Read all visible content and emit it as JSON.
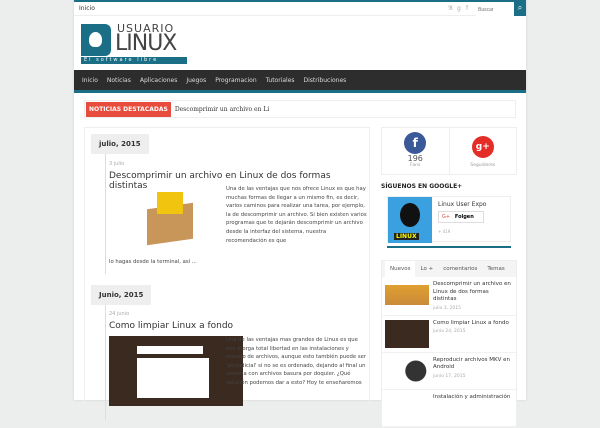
{
  "topbar": {
    "home": "Inicio",
    "search_placeholder": "Buscar"
  },
  "logo": {
    "line1": "USUARIO",
    "line2": "LINUX",
    "tagline": "El software libre"
  },
  "nav": [
    "Inicio",
    "Noticias",
    "Aplicaciones",
    "Juegos",
    "Programacion",
    "Tutoriales",
    "Distribuciones"
  ],
  "ticker": {
    "label": "NOTICIAS DESTACADAS",
    "text": "Descomprimir un archivo en Li"
  },
  "posts": [
    {
      "month": "julio, 2015",
      "date": "3 julio",
      "title": "Descomprimir un archivo en Linux de dos formas distintas",
      "excerpt": "Una de las ventajas que nos ofrece Linux es que hay muchas formas de llegar a un mismo fin, es decir, varios caminos para realizar una tarea, por ejemplo, la de descomprimir un archivo. Si bien existen varios programas que te dejarán descomprimir un archivo desde la interfaz del sistema, nuestra recomendación es que",
      "excerpt_end": "lo hagas desde la terminal, así ..."
    },
    {
      "month": "Junio, 2015",
      "date": "24 junio",
      "title": "Como limpiar Linux a fondo",
      "excerpt": "Una de las ventajas mas grandes de Linux es que nos otorga total libertad en las instalaciones y manejo de archivos, aunque esto también puede ser 'perjudicial' si no se es ordenado, dejando al final un sistema con archivos basura por doquier. ¿Qué solución podemos dar a esto? Hoy te enseñaremos"
    }
  ],
  "social": {
    "fb_count": "196",
    "fb_label": "Fans",
    "gp_label": "Seguidores"
  },
  "gplus": {
    "heading": "SÍGUENOS EN GOOGLE+",
    "page": "Linux User Expo",
    "follow": "Folgen",
    "count": "+ 419",
    "img_text": "LINUX"
  },
  "tabs": [
    "Nuevos",
    "Lo +",
    "comentarios",
    "Temas"
  ],
  "recent": [
    {
      "title": "Descomprimir un archivo en Linux de dos formas distintas",
      "date": "julio 3, 2015"
    },
    {
      "title": "Como limpiar Linux a fondo",
      "date": "junio 24, 2015"
    },
    {
      "title": "Reproducir archivos MKV en Android",
      "date": "junio 17, 2015"
    },
    {
      "title": "Instalación y administración",
      "date": ""
    }
  ]
}
